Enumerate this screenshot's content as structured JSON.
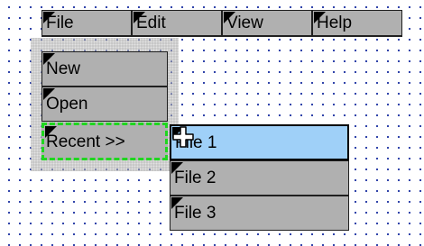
{
  "menubar": {
    "items": [
      {
        "label": "File"
      },
      {
        "label": "Edit"
      },
      {
        "label": "View"
      },
      {
        "label": "Help"
      }
    ]
  },
  "file_menu": {
    "items": [
      {
        "label": "New"
      },
      {
        "label": "Open"
      },
      {
        "label": "Recent >>"
      }
    ]
  },
  "recent_submenu": {
    "items": [
      {
        "label": "File 1"
      },
      {
        "label": "File 2"
      },
      {
        "label": "File 3"
      }
    ]
  },
  "colors": {
    "menu_background": "#b0b0b0",
    "selection": "#9fd0f8",
    "focus_outline": "#1fd61f",
    "grid_dots": "#1a2fa0"
  },
  "cursor": {
    "icon": "move-cursor-icon"
  }
}
